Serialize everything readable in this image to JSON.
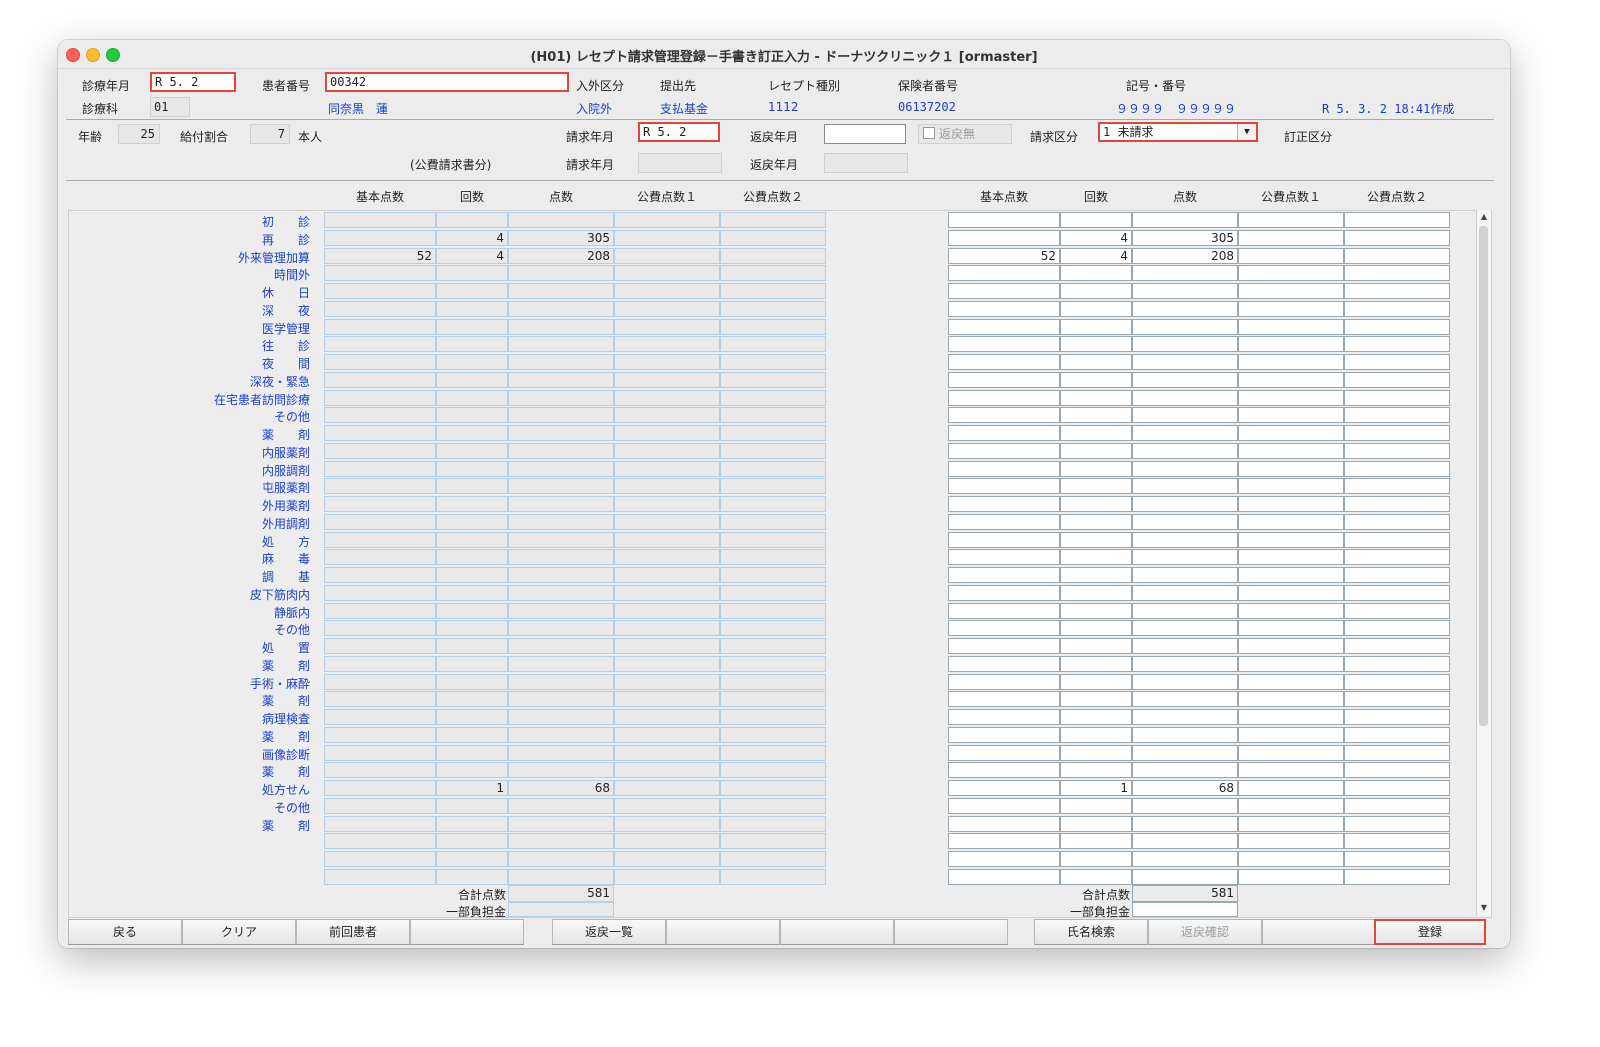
{
  "window_title": "(H01) レセプト請求管理登録－手書き訂正入力 - ドーナツクリニック１ [ormaster]",
  "header": {
    "shinryo_ym_label": "診療年月",
    "shinryo_ym": "R 5. 2",
    "patient_no_label": "患者番号",
    "patient_no": "00342",
    "nyugai_label": "入外区分",
    "nyugai_value": "入院外",
    "teishutsu_label": "提出先",
    "teishutsu_value": "支払基金",
    "receipt_kind_label": "レセプト種別",
    "receipt_kind_value": "1112",
    "hokensha_label": "保険者番号",
    "hokensha_value": "06137202",
    "kigo_label": "記号・番号",
    "kigo_value": "９９９９　９９９９９",
    "created": "R 5. 3. 2 18:41作成",
    "shinryoka_label": "診療科",
    "shinryoka": "01",
    "patient_name": "同奈黒　蓮",
    "age_label": "年齢",
    "age": "25",
    "kyufu_label": "給付割合",
    "kyufu": "7",
    "honnin": "本人",
    "seikyu_ym_label": "請求年月",
    "seikyu_ym": "R 5. 2",
    "henrei_ym_label": "返戻年月",
    "henrei_ym": "",
    "henrei_nashi": "返戻無",
    "seikyu_kubun_label": "請求区分",
    "seikyu_kubun": "1 未請求",
    "teisei_label": "訂正区分",
    "kohi_note": "(公費請求書分)",
    "seikyu_ym2_label": "請求年月",
    "henrei_ym2_label": "返戻年月"
  },
  "columns": [
    "基本点数",
    "回数",
    "点数",
    "公費点数１",
    "公費点数２"
  ],
  "rows": [
    {
      "label": "初　　診",
      "kihon": "",
      "kaisu": "",
      "tensu": ""
    },
    {
      "label": "再　　診",
      "kihon": "",
      "kaisu": "4",
      "tensu": "305"
    },
    {
      "label": "外来管理加算",
      "kihon": "52",
      "kaisu": "4",
      "tensu": "208"
    },
    {
      "label": "時間外",
      "kihon": "",
      "kaisu": "",
      "tensu": ""
    },
    {
      "label": "休　　日",
      "kihon": "",
      "kaisu": "",
      "tensu": ""
    },
    {
      "label": "深　　夜",
      "kihon": "",
      "kaisu": "",
      "tensu": ""
    },
    {
      "label": "医学管理",
      "kihon": "",
      "kaisu": "",
      "tensu": ""
    },
    {
      "label": "往　　診",
      "kihon": "",
      "kaisu": "",
      "tensu": ""
    },
    {
      "label": "夜　　間",
      "kihon": "",
      "kaisu": "",
      "tensu": ""
    },
    {
      "label": "深夜・緊急",
      "kihon": "",
      "kaisu": "",
      "tensu": ""
    },
    {
      "label": "在宅患者訪問診療",
      "kihon": "",
      "kaisu": "",
      "tensu": ""
    },
    {
      "label": "その他",
      "kihon": "",
      "kaisu": "",
      "tensu": ""
    },
    {
      "label": "薬　　剤",
      "kihon": "",
      "kaisu": "",
      "tensu": ""
    },
    {
      "label": "内服薬剤",
      "kihon": "",
      "kaisu": "",
      "tensu": ""
    },
    {
      "label": "内服調剤",
      "kihon": "",
      "kaisu": "",
      "tensu": ""
    },
    {
      "label": "屯服薬剤",
      "kihon": "",
      "kaisu": "",
      "tensu": ""
    },
    {
      "label": "外用薬剤",
      "kihon": "",
      "kaisu": "",
      "tensu": ""
    },
    {
      "label": "外用調剤",
      "kihon": "",
      "kaisu": "",
      "tensu": ""
    },
    {
      "label": "処　　方",
      "kihon": "",
      "kaisu": "",
      "tensu": ""
    },
    {
      "label": "麻　　毒",
      "kihon": "",
      "kaisu": "",
      "tensu": ""
    },
    {
      "label": "調　　基",
      "kihon": "",
      "kaisu": "",
      "tensu": ""
    },
    {
      "label": "皮下筋肉内",
      "kihon": "",
      "kaisu": "",
      "tensu": ""
    },
    {
      "label": "静脈内",
      "kihon": "",
      "kaisu": "",
      "tensu": ""
    },
    {
      "label": "その他",
      "kihon": "",
      "kaisu": "",
      "tensu": ""
    },
    {
      "label": "処　　置",
      "kihon": "",
      "kaisu": "",
      "tensu": ""
    },
    {
      "label": "薬　　剤",
      "kihon": "",
      "kaisu": "",
      "tensu": ""
    },
    {
      "label": "手術・麻酔",
      "kihon": "",
      "kaisu": "",
      "tensu": ""
    },
    {
      "label": "薬　　剤",
      "kihon": "",
      "kaisu": "",
      "tensu": ""
    },
    {
      "label": "病理検査",
      "kihon": "",
      "kaisu": "",
      "tensu": ""
    },
    {
      "label": "薬　　剤",
      "kihon": "",
      "kaisu": "",
      "tensu": ""
    },
    {
      "label": "画像診断",
      "kihon": "",
      "kaisu": "",
      "tensu": ""
    },
    {
      "label": "薬　　剤",
      "kihon": "",
      "kaisu": "",
      "tensu": ""
    },
    {
      "label": "処方せん",
      "kihon": "",
      "kaisu": "1",
      "tensu": "68"
    },
    {
      "label": "その他",
      "kihon": "",
      "kaisu": "",
      "tensu": ""
    },
    {
      "label": "薬　　剤",
      "kihon": "",
      "kaisu": "",
      "tensu": ""
    },
    {
      "label": "",
      "kihon": "",
      "kaisu": "",
      "tensu": ""
    },
    {
      "label": "",
      "kihon": "",
      "kaisu": "",
      "tensu": ""
    },
    {
      "label": "",
      "kihon": "",
      "kaisu": "",
      "tensu": ""
    }
  ],
  "totals": {
    "gokei_label": "合計点数",
    "gokei": "581",
    "ichibu_label": "一部負担金",
    "ichibu": ""
  },
  "buttons": [
    "戻る",
    "クリア",
    "前回患者",
    "",
    "返戻一覧",
    "",
    "",
    "",
    "氏名検索",
    "返戻確認",
    "",
    "登録"
  ],
  "colors": {
    "accent_red": "#e2453a",
    "label_blue": "#1a3fcc"
  }
}
